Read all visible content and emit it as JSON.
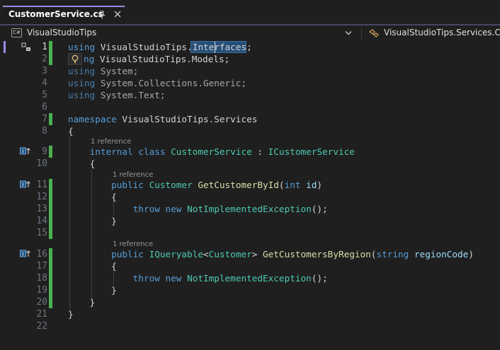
{
  "tab": {
    "title": "CustomerService.cs",
    "pin_icon": "pin-icon",
    "close_icon": "close-icon"
  },
  "navbar": {
    "project": "VisualStudioTips",
    "project_badge": "C#",
    "type_scope": "VisualStudioTips.Services.Custo"
  },
  "editor": {
    "line_numbers": [
      "1",
      "2",
      "3",
      "4",
      "5",
      "6",
      "7",
      "8",
      "9",
      "10",
      "11",
      "12",
      "13",
      "14",
      "15",
      "16",
      "17",
      "18",
      "19",
      "20",
      "21",
      "22"
    ],
    "lens": {
      "class_refs": "1 reference",
      "method1_refs": "1 reference",
      "method2_refs": "1 reference"
    },
    "tokens": {
      "using": "using",
      "vs_tips": "VisualStudioTips",
      "dot": ".",
      "interfaces_a": "Inter",
      "interfaces_b": "faces",
      "semi": ";",
      "models_pre": "ng",
      "models": "VisualStudioTips.Models",
      "system": "System",
      "collections": "System.Collections.Generic",
      "text": "System.Text",
      "namespace": "namespace",
      "services_ns": "VisualStudioTips.Services",
      "open_brace": "{",
      "close_brace": "}",
      "internal": "internal",
      "class": "class",
      "customer_service": "CustomerService",
      "colon": ":",
      "icustomer_service": "ICustomerService",
      "public": "public",
      "customer": "Customer",
      "get_by_id": "GetCustomerById",
      "int": "int",
      "id": "id",
      "throw": "throw",
      "new": "new",
      "not_impl": "NotImplementedException",
      "parens_semi": "();",
      "iqueryable": "IQueryable",
      "lt": "<",
      "gt": ">",
      "get_by_region": "GetCustomersByRegion",
      "string": "string",
      "region_code": "regionCode",
      "lparen": "(",
      "rparen": ")"
    }
  },
  "colors": {
    "accent": "#9b8ce6",
    "keyword": "#569cd6",
    "type": "#4ec9b0",
    "method": "#dcdcaa",
    "param": "#9cdcfe",
    "changed": "#4caf50"
  }
}
